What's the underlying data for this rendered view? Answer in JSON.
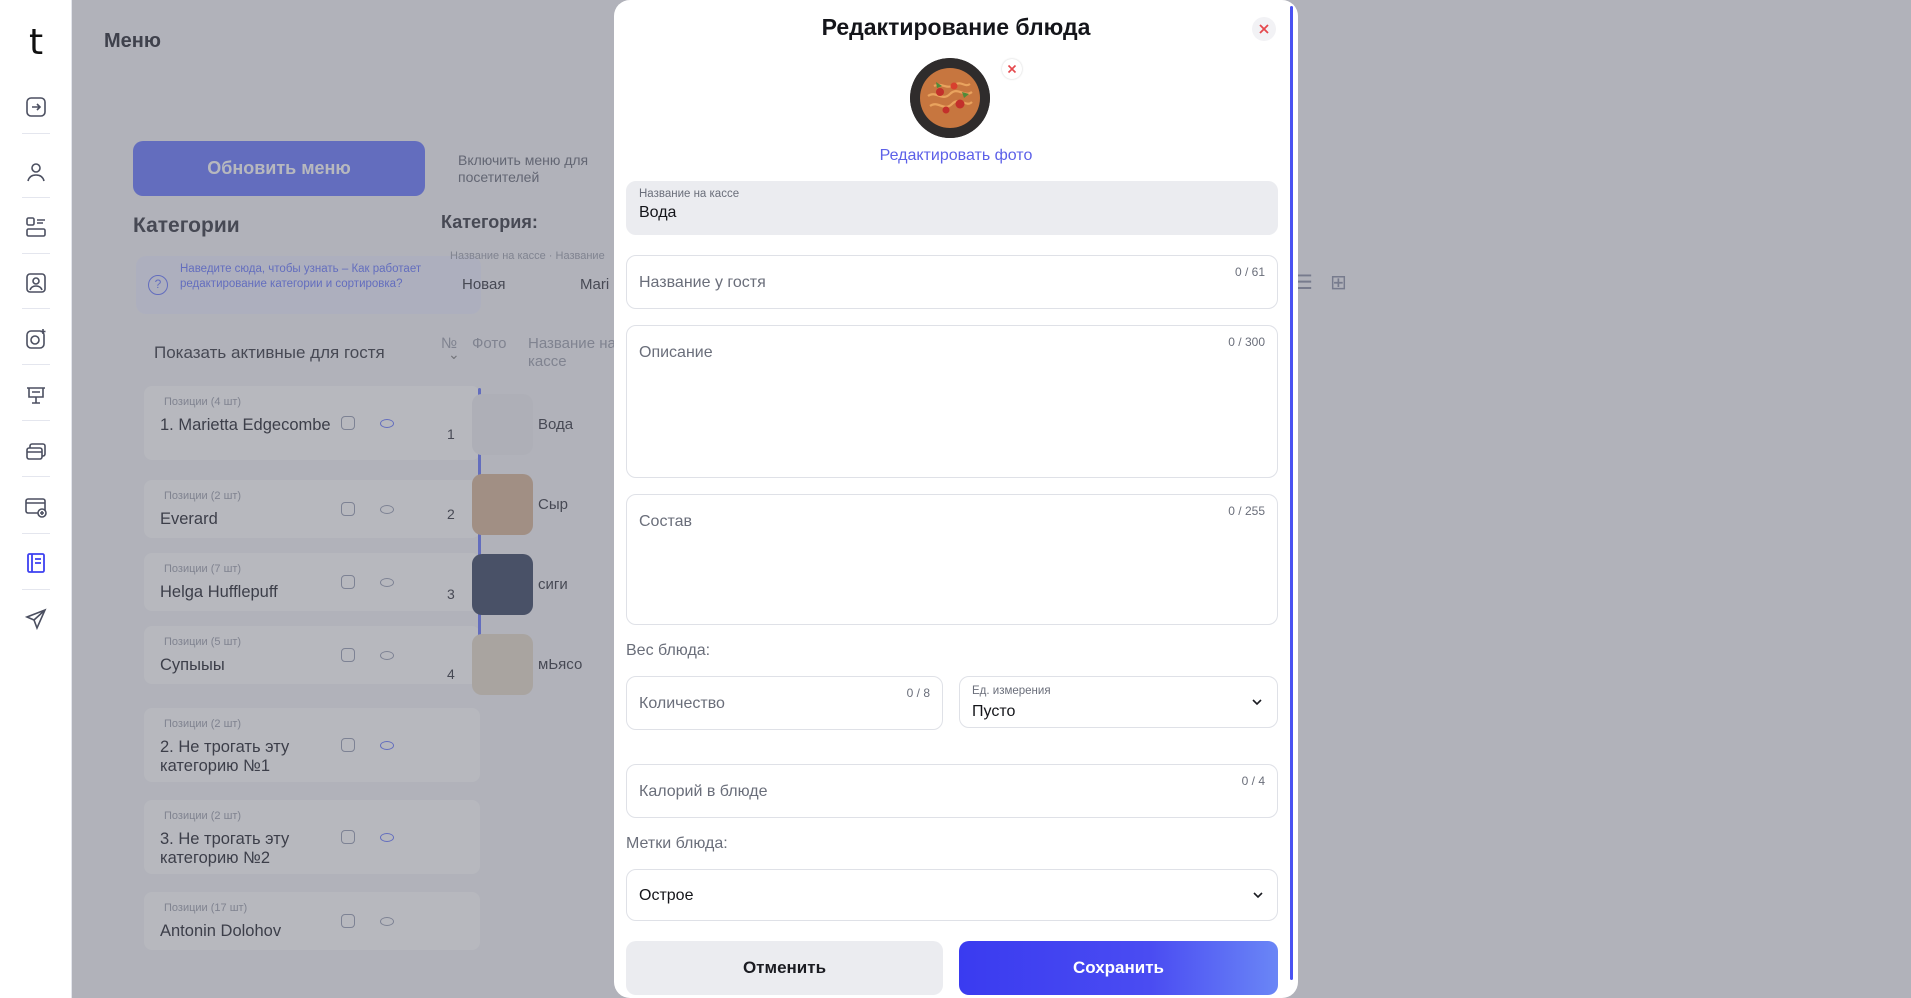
{
  "sidebar": {
    "logo": "t",
    "icons": [
      "logout-icon",
      "user-icon",
      "layout-icon",
      "contact-card-icon",
      "camera-plus-icon",
      "presentation-icon",
      "cards-icon",
      "payment-card-icon",
      "menu-book-icon",
      "send-icon"
    ],
    "active_index": 8
  },
  "page": {
    "title": "Меню",
    "refresh_button": "Обновить меню",
    "toggle_label": "Включить меню для посетителей",
    "categories_title": "Категории",
    "hint": "Наведите сюда, чтобы узнать – Как работает редактирование категории и сортировка?",
    "show_active": "Показать активные для гостя",
    "categories": [
      {
        "meta": "Позиции (4 шт)",
        "name": "1. Marietta Edgecombe",
        "visible": true
      },
      {
        "meta": "Позиции (2 шт)",
        "name": "Everard",
        "visible": false
      },
      {
        "meta": "Позиции (7 шт)",
        "name": "Helga Hufflepuff",
        "visible": false
      },
      {
        "meta": "Позиции (5 шт)",
        "name": "Супыыы",
        "visible": false
      },
      {
        "meta": "Позиции (2 шт)",
        "name": "2. Не трогать эту категорию №1",
        "visible": true
      },
      {
        "meta": "Позиции (2 шт)",
        "name": "3. Не трогать эту категорию №2",
        "visible": true
      },
      {
        "meta": "Позиции (17 шт)",
        "name": "Antonin Dolohov",
        "visible": false
      }
    ],
    "dish_category_label": "Категория:",
    "breadcrumbs": "Название на кассе · Название",
    "tabs": [
      "Новая",
      "Mari"
    ],
    "table_headers": {
      "num": "№",
      "photo": "Фото",
      "name": "Название на кассе"
    },
    "dishes": [
      {
        "num": "1",
        "name": "Вода"
      },
      {
        "num": "2",
        "name": "Сыр"
      },
      {
        "num": "3",
        "name": "сиги"
      },
      {
        "num": "4",
        "name": "мЬясо"
      }
    ]
  },
  "modal": {
    "title": "Редактирование блюда",
    "edit_photo": "Редактировать фото",
    "cashier_name": {
      "label": "Название на кассе",
      "value": "Вода"
    },
    "guest_name": {
      "placeholder": "Название у гостя",
      "counter": "0 / 61"
    },
    "description": {
      "placeholder": "Описание",
      "counter": "0 / 300"
    },
    "composition": {
      "placeholder": "Состав",
      "counter": "0 / 255"
    },
    "weight_label": "Вес блюда:",
    "quantity": {
      "placeholder": "Количество",
      "counter": "0 / 8"
    },
    "unit": {
      "label": "Ед. измерения",
      "value": "Пусто"
    },
    "calories": {
      "placeholder": "Калорий в блюде",
      "counter": "0 / 4"
    },
    "tags_label": "Метки блюда:",
    "tags_value": "Острое",
    "cancel": "Отменить",
    "save": "Сохранить"
  },
  "colors": {
    "accent": "#4a4cf2",
    "link": "#5d61e8",
    "close": "#e5484d"
  }
}
